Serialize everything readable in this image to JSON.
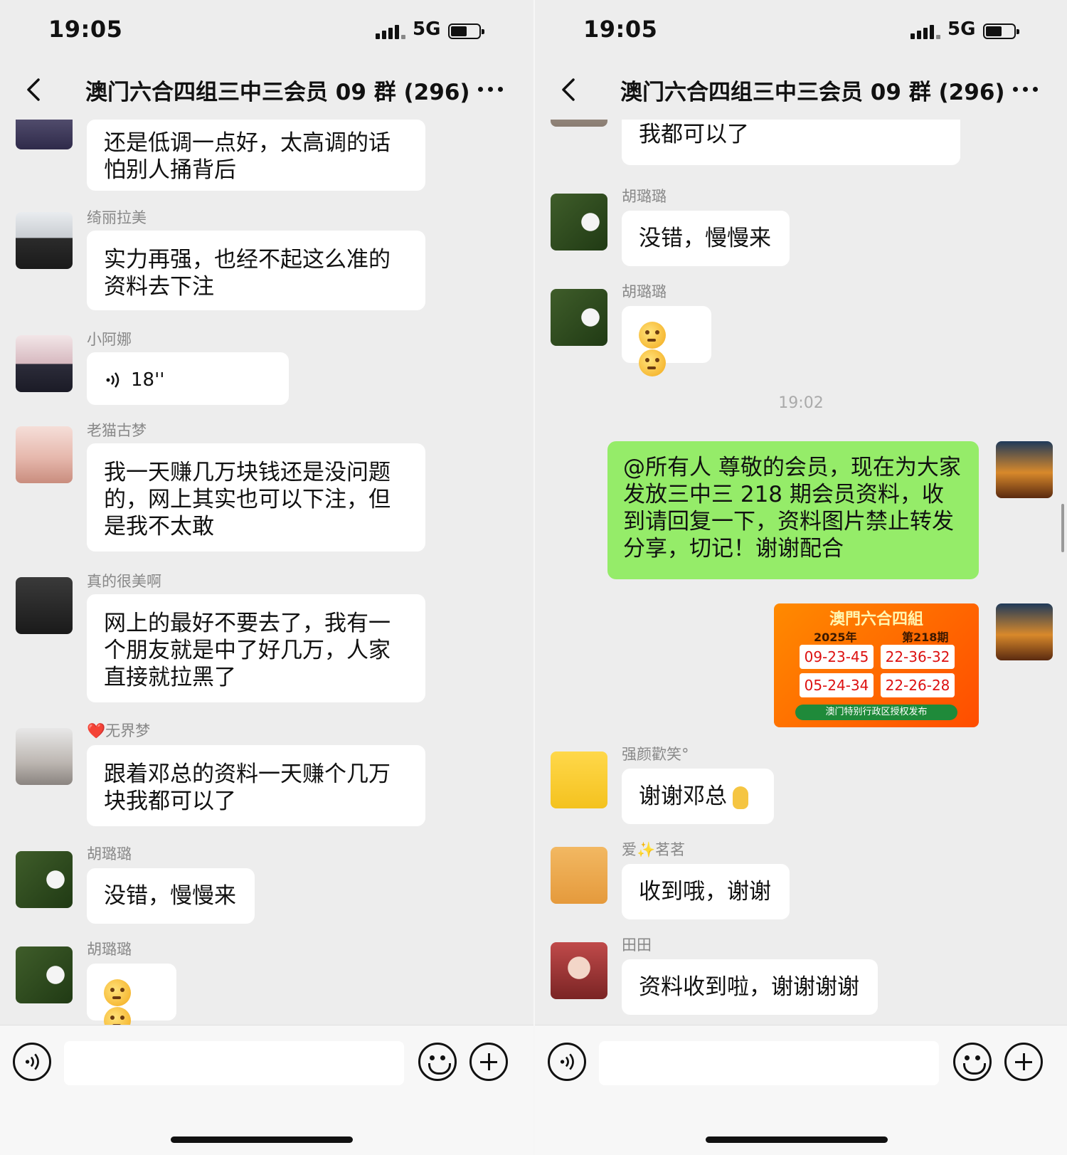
{
  "left_screen": {
    "status": {
      "time": "19:05",
      "network": "5G"
    },
    "nav": {
      "title": "澳门六合四组三中三会员 09 群 (296)"
    },
    "messages": [
      {
        "sender": "",
        "text": "还是低调一点好，太高调的话怕别人捅背后"
      },
      {
        "sender": "绮丽拉美",
        "text": "实力再强，也经不起这么准的资料去下注"
      },
      {
        "sender": "小阿娜",
        "voice_duration": "18''"
      },
      {
        "sender": "老猫古梦",
        "text": "我一天赚几万块钱还是没问题的，网上其实也可以下注，但是我不太敢"
      },
      {
        "sender": "真的很美啊",
        "text": "网上的最好不要去了，我有一个朋友就是中了好几万，人家直接就拉黑了"
      },
      {
        "sender": "❤️无界梦",
        "text": "跟着邓总的资料一天赚个几万块我都可以了"
      },
      {
        "sender": "胡璐璐",
        "text": "没错，慢慢来"
      },
      {
        "sender": "胡璐璐",
        "text": ""
      }
    ]
  },
  "right_screen": {
    "status": {
      "time": "19:05",
      "network": "5G"
    },
    "nav": {
      "title": "澳门六合四组三中三会员 09 群 (296)"
    },
    "partial_message": "我都可以了",
    "messages": [
      {
        "sender": "胡璐璐",
        "text": "没错，慢慢来"
      },
      {
        "sender": "胡璐璐",
        "text": ""
      },
      {
        "sender": "强颜歡笑°",
        "text": "谢谢邓总"
      },
      {
        "sender": "爱✨茗茗",
        "text": "收到哦，谢谢"
      },
      {
        "sender": "田田",
        "text": "资料收到啦，谢谢谢谢"
      }
    ],
    "timestamp": "19:02",
    "own_message": "@所有人 尊敬的会员，现在为大家发放三中三 218 期会员资料，收到请回复一下，资料图片禁止转发分享，切记！谢谢配合",
    "poster": {
      "header": "澳門六合四組",
      "year": "2025年",
      "issue": "第218期",
      "numbers": [
        "09-23-45",
        "22-36-32",
        "05-24-34",
        "22-26-28"
      ],
      "footer": "澳门特别行政区授权发布"
    }
  },
  "colors": {
    "background": "#ededed",
    "bubble_other": "#ffffff",
    "bubble_self": "#95ec69",
    "poster": "#ff6a00"
  },
  "icons": [
    "back-icon",
    "more-icon",
    "voice-icon",
    "emoji-icon",
    "plus-icon"
  ]
}
